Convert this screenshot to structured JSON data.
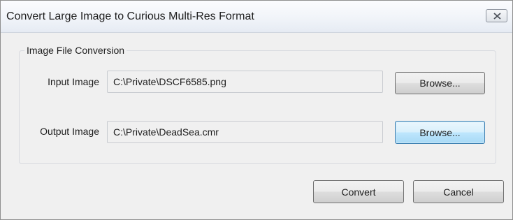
{
  "window": {
    "title": "Convert Large Image to Curious Multi-Res Format",
    "close_icon": "close-x-icon"
  },
  "group": {
    "legend": "Image File Conversion"
  },
  "input_image": {
    "label": "Input Image",
    "value": "C:\\Private\\DSCF6585.png",
    "browse_label": "Browse..."
  },
  "output_image": {
    "label": "Output Image",
    "value": "C:\\Private\\DeadSea.cmr",
    "browse_label": "Browse..."
  },
  "actions": {
    "convert_label": "Convert",
    "cancel_label": "Cancel"
  },
  "colors": {
    "dialog_background": "#f0f0f0",
    "focused_button": "#bee6fd",
    "focused_button_border": "#3c7fb1"
  }
}
